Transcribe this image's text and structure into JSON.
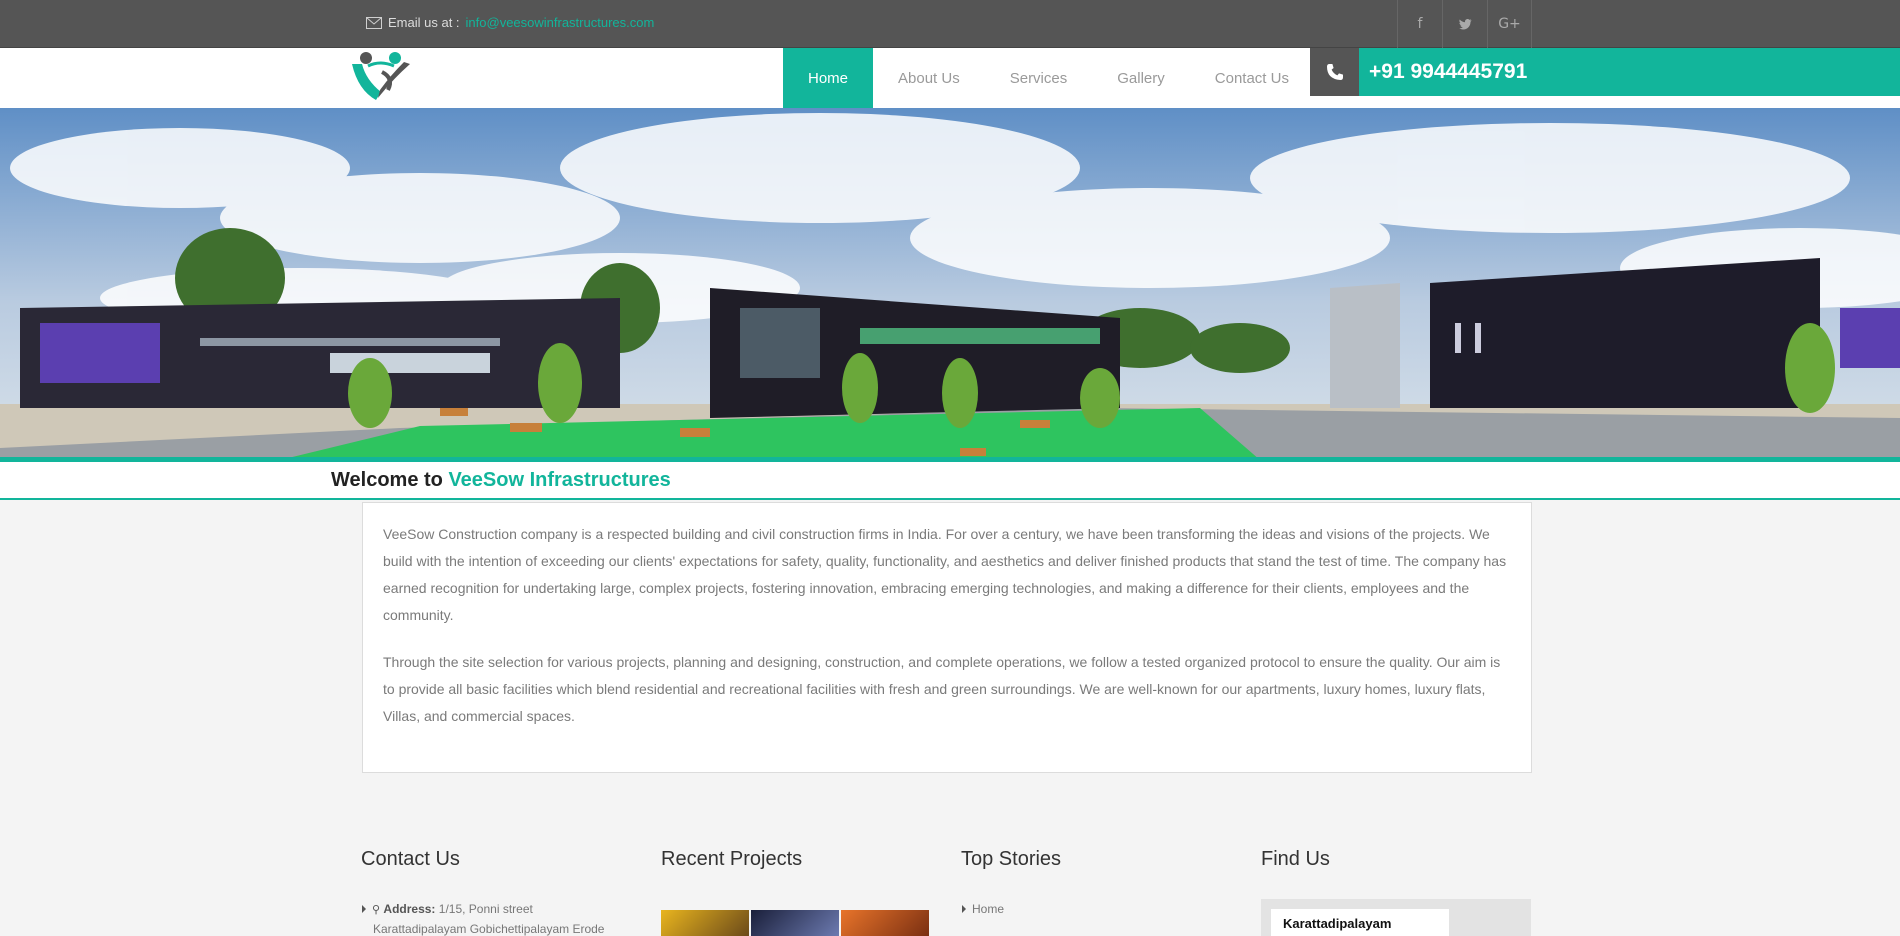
{
  "topbar": {
    "email_prefix": "Email us at :",
    "email": "info@veesowinfrastructures.com",
    "social": [
      "f",
      "t",
      "G+"
    ]
  },
  "nav": {
    "items": [
      {
        "label": "Home",
        "active": true
      },
      {
        "label": "About Us"
      },
      {
        "label": "Services"
      },
      {
        "label": "Gallery"
      },
      {
        "label": "Contact Us"
      }
    ],
    "phone": "+91 9944445791"
  },
  "welcome": {
    "prefix": "Welcome to",
    "brand": "VeeSow Infrastructures"
  },
  "content": {
    "paragraphs": [
      "VeeSow Construction company is a respected building and civil construction firms in India. For over a century, we have been transforming the ideas and visions of the projects. We build with the intention of exceeding our clients' expectations for safety, quality, functionality, and aesthetics and deliver finished products that stand the test of time.  The company has earned recognition for undertaking large, complex projects, fostering innovation, embracing emerging technologies, and making a difference for their clients, employees and the community.",
      "Through the site selection for various projects, planning and designing, construction, and complete operations, we follow a tested organized protocol to ensure the quality. Our aim is to provide all basic facilities which blend residential and recreational facilities with fresh and green surroundings. We are well-known for our apartments, luxury homes, luxury flats, Villas, and commercial spaces."
    ]
  },
  "footer": {
    "contact": {
      "title": "Contact Us",
      "address_label": "Address:",
      "address_line1": "1/15, Ponni street",
      "address_line2": "Karattadipalayam Gobichettipalayam Erode"
    },
    "projects": {
      "title": "Recent Projects"
    },
    "stories": {
      "title": "Top Stories",
      "items": [
        "Home"
      ]
    },
    "find": {
      "title": "Find Us",
      "map_label": "Karattadipalayam"
    }
  },
  "colors": {
    "accent": "#12b59b",
    "topbar": "#555555"
  }
}
